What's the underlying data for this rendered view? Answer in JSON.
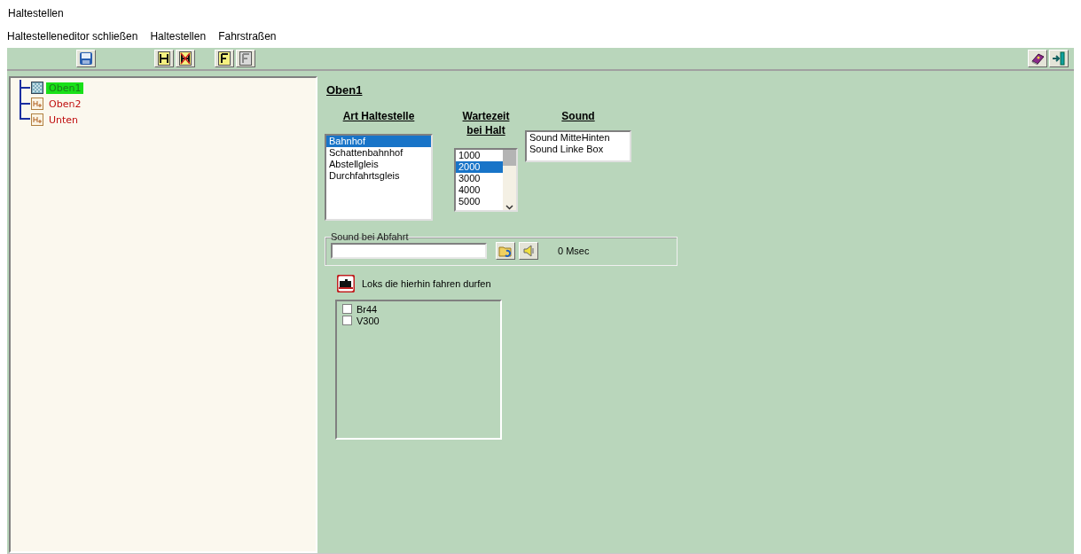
{
  "window": {
    "title": "Haltestellen"
  },
  "menu": [
    "Haltestelleneditor schließen",
    "Haltestellen",
    "Fahrstraßen"
  ],
  "tree": [
    {
      "label": "Oben1",
      "selected": true
    },
    {
      "label": "Oben2",
      "selected": false
    },
    {
      "label": "Unten",
      "selected": false
    }
  ],
  "editor": {
    "heading": "Oben1",
    "stop_type": {
      "label": "Art Haltestelle",
      "items": [
        {
          "label": "Bahnhof",
          "selected": true
        },
        {
          "label": "Schattenbahnhof",
          "selected": false
        },
        {
          "label": "Abstellgleis",
          "selected": false
        },
        {
          "label": "Durchfahrtsgleis",
          "selected": false
        }
      ]
    },
    "wait_time": {
      "label_line_1": "Wartezeit",
      "label_line_2": "bei Halt",
      "items": [
        {
          "label": "1000",
          "selected": false
        },
        {
          "label": "2000",
          "selected": true
        },
        {
          "label": "3000",
          "selected": false
        },
        {
          "label": "4000",
          "selected": false
        },
        {
          "label": "5000",
          "selected": false
        }
      ]
    },
    "sound": {
      "label": "Sound",
      "items": [
        {
          "label": "Sound MitteHinten",
          "selected": false
        },
        {
          "label": "Sound Linke Box",
          "selected": false
        }
      ]
    },
    "departure_sound": {
      "label": "Sound bei Abfahrt",
      "duration": "0 Msec"
    },
    "locos": {
      "label": "Loks die hierhin fahren durfen",
      "items": [
        {
          "label": "Br44",
          "checked": false
        },
        {
          "label": "V300",
          "checked": false
        }
      ]
    }
  }
}
